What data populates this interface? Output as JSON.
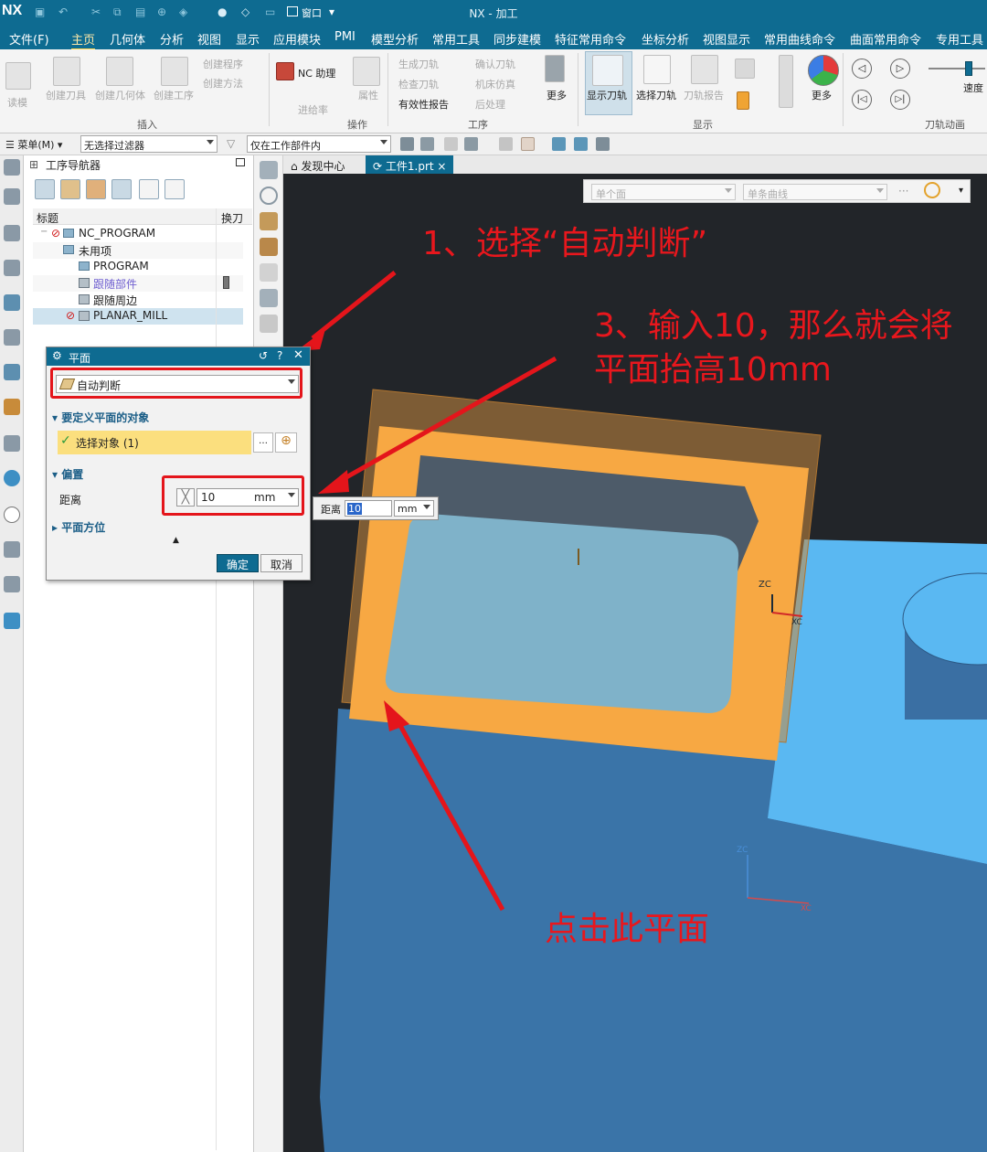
{
  "app": {
    "logo": "NX",
    "title": "NX - 加工",
    "window_label": "窗口"
  },
  "menu_tabs": [
    "文件(F)",
    "主页",
    "几何体",
    "分析",
    "视图",
    "显示",
    "应用模块",
    "PMI",
    "模型分析",
    "常用工具",
    "同步建模",
    "特征常用命令",
    "坐标分析",
    "视图显示",
    "常用曲线命令",
    "曲面常用命令",
    "专用工具"
  ],
  "ribbon": {
    "insert_group": "插入",
    "operation_group": "操作",
    "process_group": "工序",
    "display_group": "显示",
    "toolpath_anim_group": "刀轨动画",
    "create_tool": "创建刀具",
    "create_geometry": "创建几何体",
    "create_operation": "创建工序",
    "create_program": "创建程序",
    "create_method": "创建方法",
    "nc_assistant": "NC 助理",
    "feed_rate": "进给率",
    "properties": "属性",
    "generate_toolpath": "生成刀轨",
    "verify_toolpath": "确认刀轨",
    "check_toolpath": "检查刀轨",
    "machine_simulation": "机床仿真",
    "validity_report": "有效性报告",
    "postprocess": "后处理",
    "more": "更多",
    "show_toolpath": "显示刀轨",
    "select_toolpath": "选择刀轨",
    "toolpath_report": "刀轨报告",
    "speed": "速度",
    "read_button": "读模"
  },
  "filterbar": {
    "menu": "菜单(M)",
    "filter": "无选择过滤器",
    "scope": "仅在工作部件内"
  },
  "navigator": {
    "title": "工序导航器",
    "col_name": "标题",
    "col_tool": "换刀",
    "rows": [
      "NC_PROGRAM",
      "未用项",
      "PROGRAM",
      "跟随部件",
      "跟随周边",
      "PLANAR_MILL"
    ]
  },
  "tabs": {
    "discovery": "发现中心",
    "part": "工件1.prt"
  },
  "viewport_filter": {
    "face": "单个面",
    "curve": "单条曲线"
  },
  "dialog": {
    "title": "平面",
    "type_value": "自动判断",
    "section_object": "要定义平面的对象",
    "select_object": "选择对象 (1)",
    "section_offset": "偏置",
    "distance_label": "距离",
    "distance_value": "10",
    "unit": "mm",
    "section_orientation": "平面方位",
    "ok": "确定",
    "cancel": "取消"
  },
  "float_input": {
    "label": "距离",
    "value": "10",
    "unit": "mm"
  },
  "annotations": {
    "step1": "1、选择“自动判断”",
    "step3_line1": "3、输入10，那么就会将",
    "step3_line2": "平面抬高10mm",
    "click_plane": "点击此平面"
  },
  "axis": {
    "zc": "ZC",
    "xc": "XC"
  },
  "colors": {
    "brand": "#0e6b91",
    "annotation": "#e4151b",
    "plane": "#f7a843",
    "part_top": "#5ab8f2",
    "part_side": "#3a74a8",
    "viewport_bg": "#222529"
  }
}
